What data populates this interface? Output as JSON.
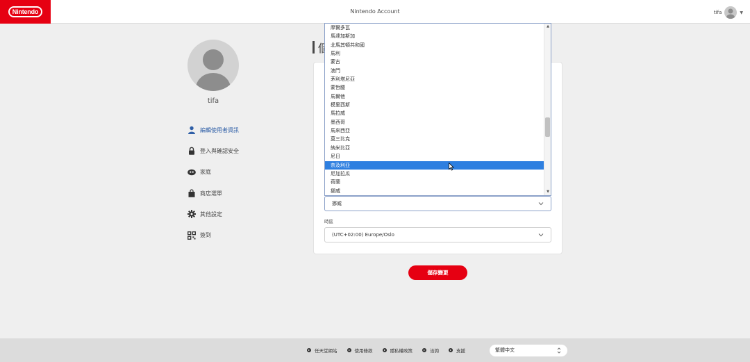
{
  "header": {
    "logo_text": "Nintendo",
    "title": "Nintendo Account",
    "username": "tifa"
  },
  "sidebar": {
    "profile_name": "tifa",
    "items": [
      {
        "label": "編輯使用者資訊",
        "icon": "user-icon",
        "active": true
      },
      {
        "label": "登入與確認安全",
        "icon": "lock-icon",
        "active": false
      },
      {
        "label": "家庭",
        "icon": "family-icon",
        "active": false
      },
      {
        "label": "商店選單",
        "icon": "shopping-bag-icon",
        "active": false
      },
      {
        "label": "其他設定",
        "icon": "gear-icon",
        "active": false
      },
      {
        "label": "簽到",
        "icon": "qr-code-icon",
        "active": false
      }
    ]
  },
  "main": {
    "heading": "個",
    "country_options": [
      "摩爾多瓦",
      "馬達加斯加",
      "北馬其頓共和國",
      "馬利",
      "蒙古",
      "澳門",
      "茅利塔尼亞",
      "蒙哲臘",
      "馬爾他",
      "模里西斯",
      "馬拉威",
      "墨西哥",
      "馬來西亞",
      "莫三比克",
      "納米比亞",
      "尼日",
      "奈及利亞",
      "尼加拉瓜",
      "荷蘭",
      "挪威"
    ],
    "country_highlighted": "奈及利亞",
    "country_value": "挪威",
    "timezone_label": "時區",
    "timezone_value": "(UTC+02:00) Europe/Oslo",
    "save_label": "儲存變更"
  },
  "footer": {
    "links": [
      "任天堂網站",
      "使用條款",
      "隱私權政策",
      "洽詢",
      "支援"
    ],
    "language": "繁體中文"
  },
  "colors": {
    "brand_red": "#e60012",
    "link_blue": "#2f5fa7",
    "selection_blue": "#2e7fe0"
  }
}
